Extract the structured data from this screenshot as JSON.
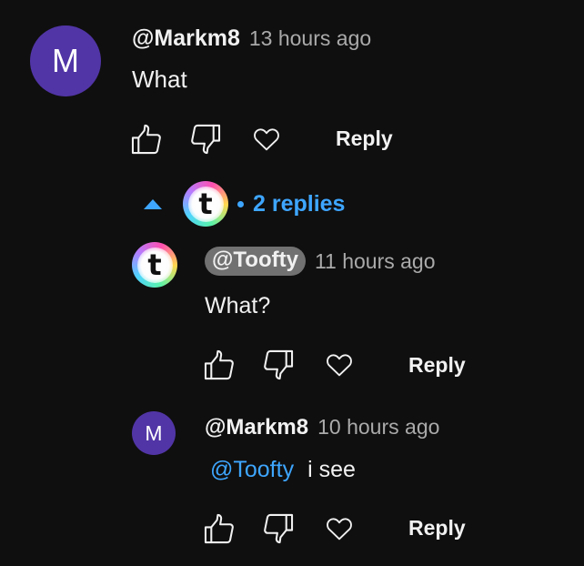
{
  "comment": {
    "avatar_letter": "M",
    "author": "@Markm8",
    "time": "13 hours ago",
    "text": "What",
    "reply_label": "Reply"
  },
  "replies_toggle": {
    "avatar_letter": "t",
    "label": "2 replies",
    "expanded": true
  },
  "replies": [
    {
      "avatar_letter": "t",
      "author": "@Toofty",
      "author_highlighted": true,
      "time": "11 hours ago",
      "text": "What?",
      "reply_label": "Reply"
    },
    {
      "avatar_letter": "M",
      "author": "@Markm8",
      "author_highlighted": false,
      "time": "10 hours ago",
      "mention": "@Toofty",
      "text": "i see",
      "reply_label": "Reply"
    }
  ],
  "icons": {
    "like": "thumbs-up-icon",
    "dislike": "thumbs-down-icon",
    "heart": "heart-icon",
    "collapse": "caret-up-icon"
  },
  "colors": {
    "background": "#0f0f0f",
    "accent_blue": "#3ea6ff",
    "avatar_purple": "#5135a6",
    "chip_gray": "#717171",
    "secondary_text": "#aaaaaa"
  }
}
